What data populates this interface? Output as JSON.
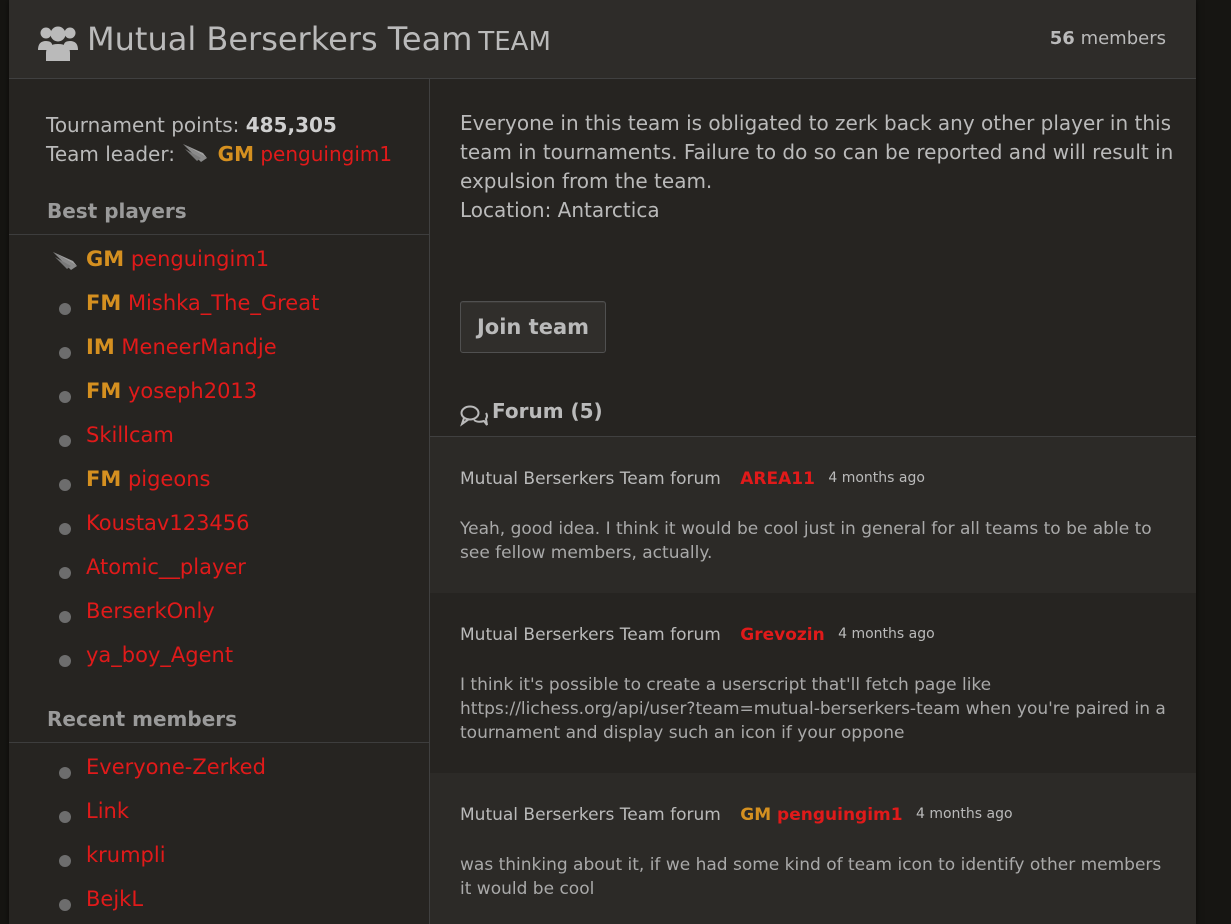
{
  "header": {
    "team_name": "Mutual Berserkers Team",
    "team_suffix": "TEAM",
    "members_count": "56",
    "members_label": "members"
  },
  "info": {
    "points_label": "Tournament points:",
    "points_value": "485,305",
    "leader_label": "Team leader:",
    "leader_title": "GM",
    "leader_name": "penguingim1"
  },
  "best_players": {
    "heading": "Best players",
    "items": [
      {
        "title": "GM",
        "name": "penguingim1",
        "icon": "wing-icon"
      },
      {
        "title": "FM",
        "name": "Mishka_The_Great",
        "icon": "offline-dot"
      },
      {
        "title": "IM",
        "name": "MeneerMandje",
        "icon": "offline-dot"
      },
      {
        "title": "FM",
        "name": "yoseph2013",
        "icon": "offline-dot"
      },
      {
        "title": "",
        "name": "Skillcam",
        "icon": "offline-dot"
      },
      {
        "title": "FM",
        "name": "pigeons",
        "icon": "offline-dot"
      },
      {
        "title": "",
        "name": "Koustav123456",
        "icon": "offline-dot"
      },
      {
        "title": "",
        "name": "Atomic__player",
        "icon": "offline-dot"
      },
      {
        "title": "",
        "name": "BerserkOnly",
        "icon": "offline-dot"
      },
      {
        "title": "",
        "name": "ya_boy_Agent",
        "icon": "offline-dot"
      }
    ]
  },
  "recent_members": {
    "heading": "Recent members",
    "items": [
      {
        "name": "Everyone-Zerked"
      },
      {
        "name": "Link"
      },
      {
        "name": "krumpli"
      },
      {
        "name": "BejkL"
      }
    ]
  },
  "description": {
    "text": "Everyone in this team is obligated to zerk back any other player in this team in tournaments. Failure to do so can be reported and will result in expulsion from the team.",
    "location": "Location: Antarctica"
  },
  "join_button": "Join team",
  "forum": {
    "title": "Forum (5)",
    "posts": [
      {
        "forum": "Mutual Berserkers Team forum",
        "author_title": "",
        "author": "AREA11",
        "ago": "4 months ago",
        "text": "Yeah, good idea. I think it would be cool just in general for all teams to be able to see fellow members, actually."
      },
      {
        "forum": "Mutual Berserkers Team forum",
        "author_title": "",
        "author": "Grevozin",
        "ago": "4 months ago",
        "text": "I think it's possible to create a userscript that'll fetch page like https://lichess.org/api/user?team=mutual-berserkers-team when you're paired in a tournament and display such an icon if your oppone"
      },
      {
        "forum": "Mutual Berserkers Team forum",
        "author_title": "GM",
        "author": "penguingim1",
        "ago": "4 months ago",
        "text": "was thinking about it, if we had some kind of team icon to identify other members it would be cool"
      }
    ]
  },
  "colors": {
    "background": "#161512",
    "panel": "#262421",
    "user_link": "#e01a1a",
    "title": "#d59020"
  }
}
